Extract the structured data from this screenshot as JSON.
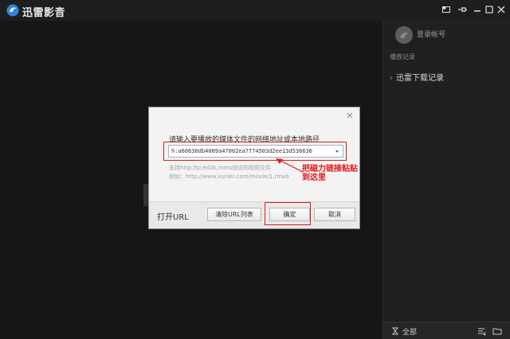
{
  "app": {
    "title": "迅雷影音"
  },
  "sidebar": {
    "login_label": "登录帐号",
    "section_title": "播放记录",
    "history_item": "迅雷下载记录",
    "filter_label": "全部"
  },
  "dialog": {
    "prompt": "请输入要播放的媒体文件的网络地址或本地路径",
    "url_value": "h:a60630db4009a47002ea7774503d2ee13d536636",
    "hint_protocols": "支持http,ftp,ed2k,mms协议的视频文件",
    "hint_example": "例如：http://www.xunlei.com/movie/1.rmvb",
    "open_url_label": "打开URL",
    "clear_button": "清除URL列表",
    "ok_button": "确定",
    "cancel_button": "取消"
  },
  "annotation": {
    "text": "把磁力链接粘贴到这里",
    "color": "#e01b1b"
  },
  "icons": {
    "logo": "xunlei-logo-icon",
    "filter": "hourglass-icon"
  }
}
